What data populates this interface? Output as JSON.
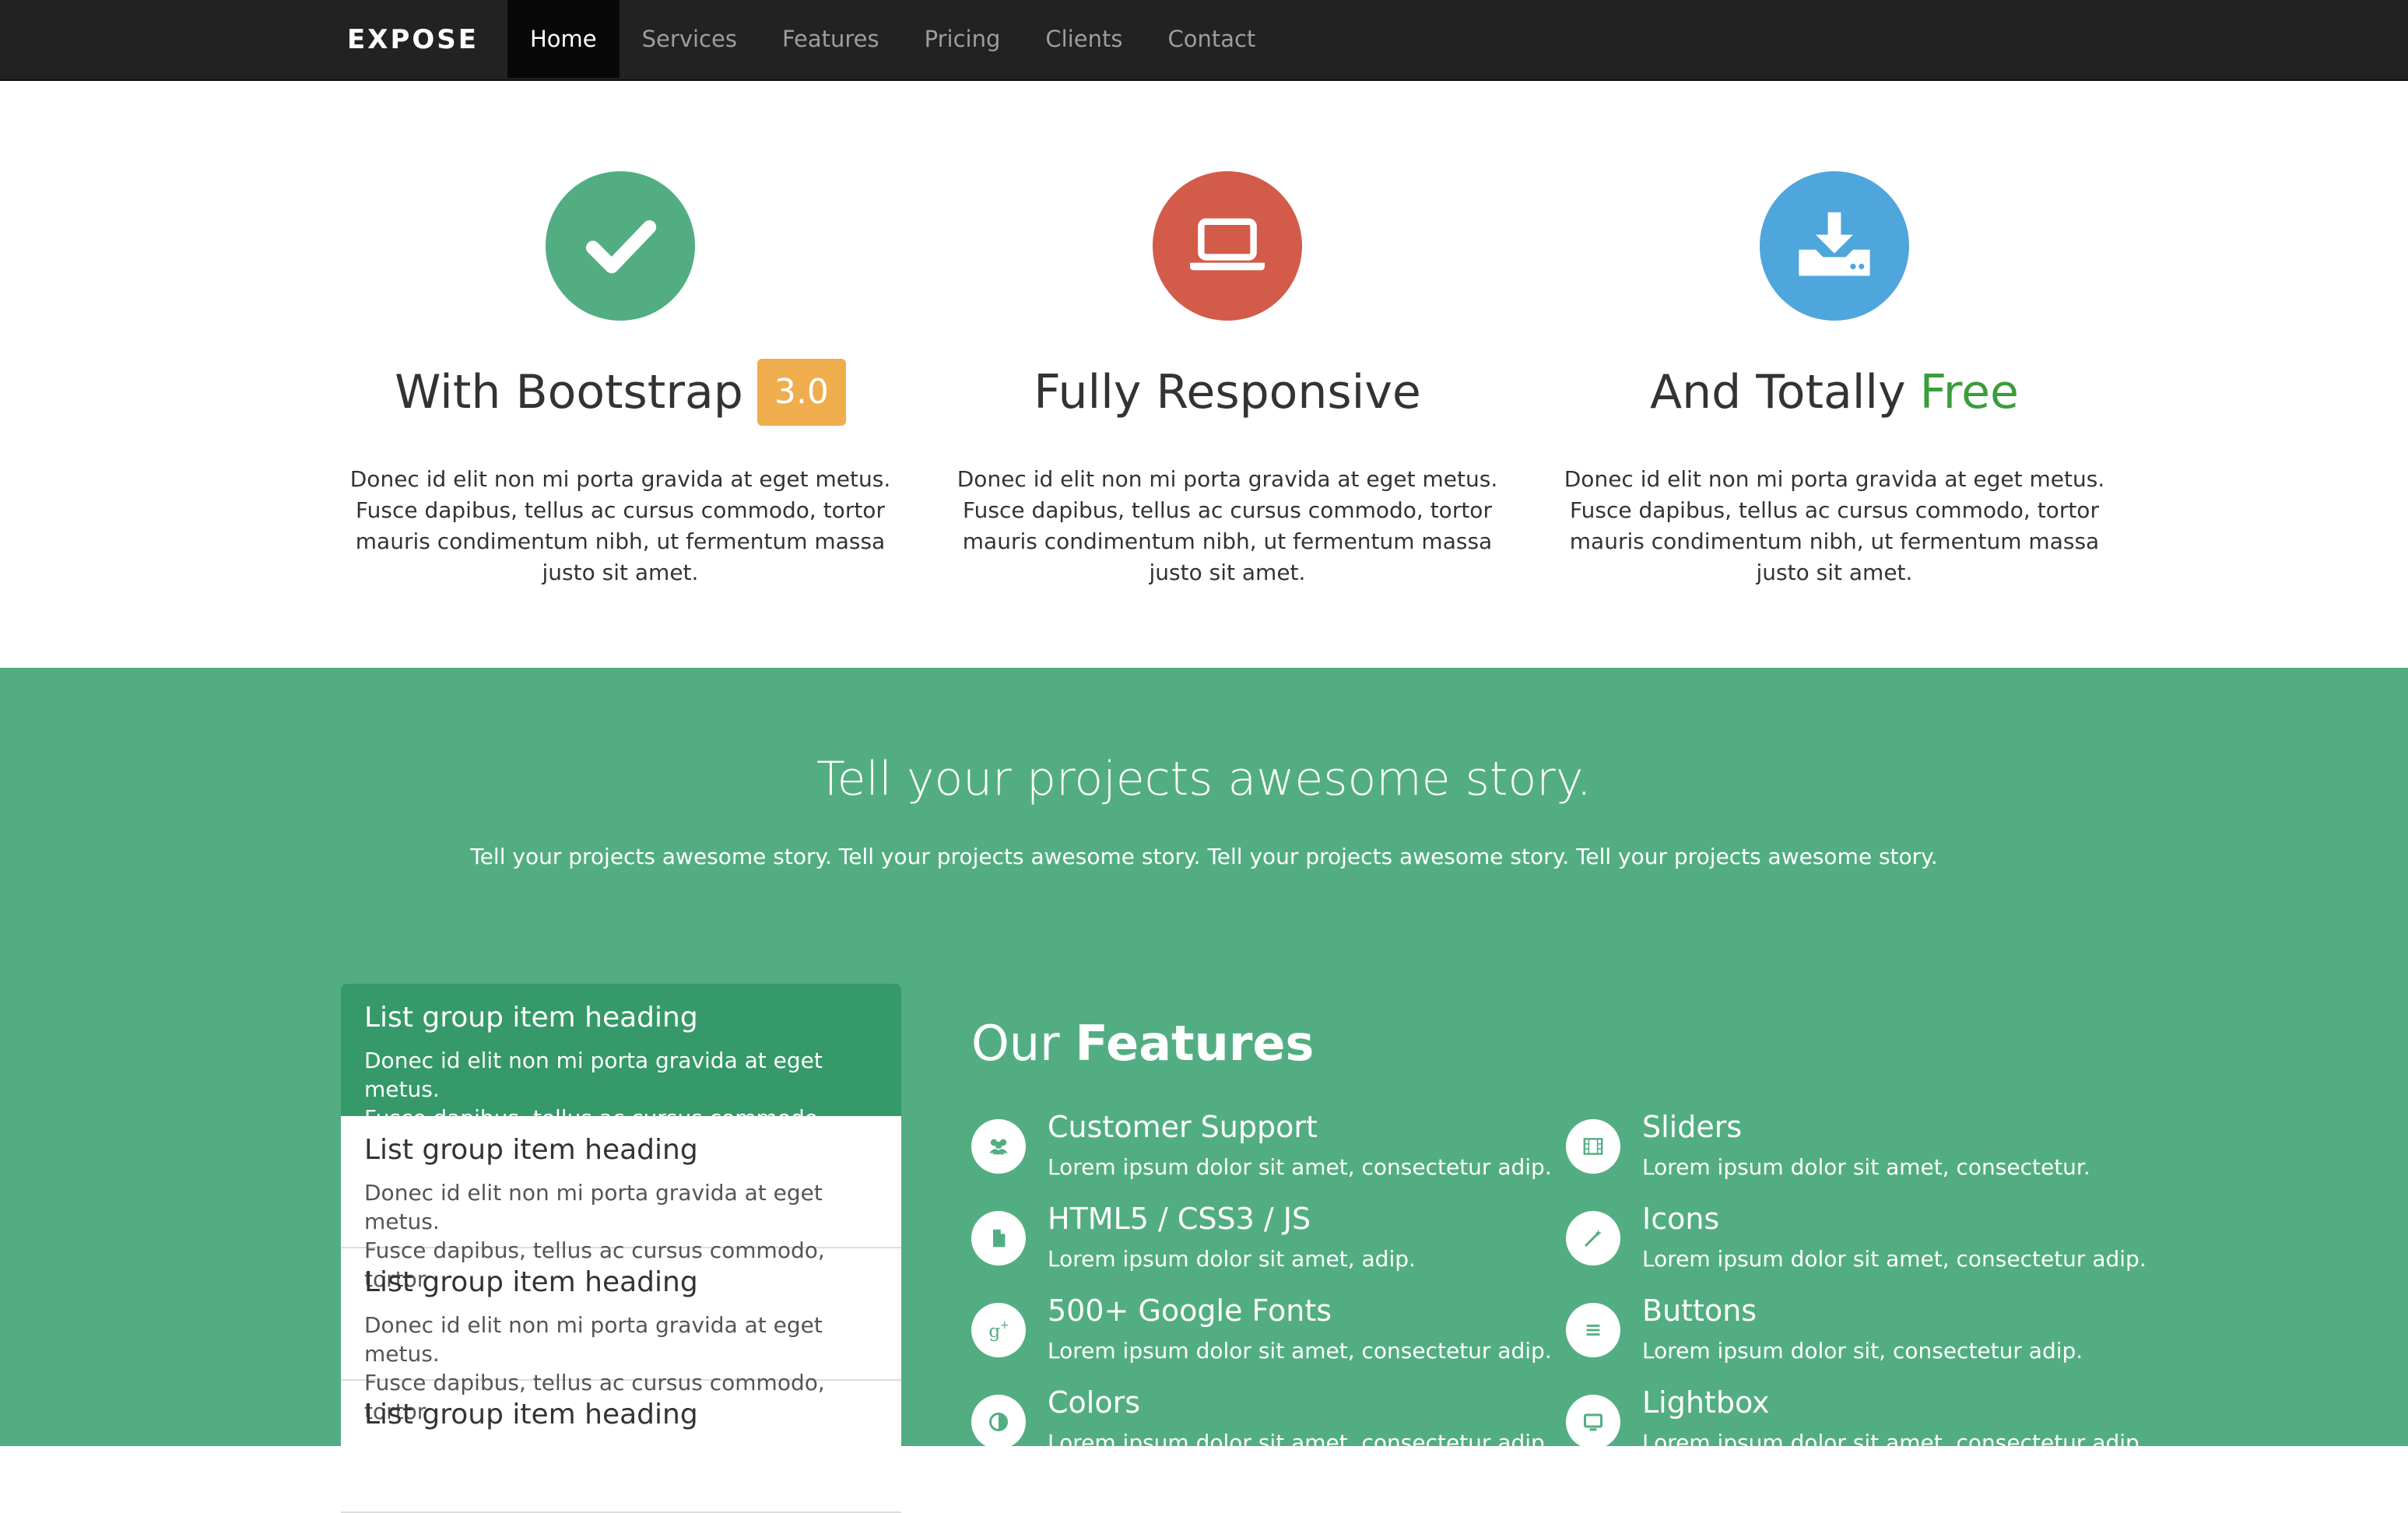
{
  "navbar": {
    "brand": "EXPOSE",
    "items": [
      {
        "label": "Home",
        "active": true
      },
      {
        "label": "Services"
      },
      {
        "label": "Features"
      },
      {
        "label": "Pricing"
      },
      {
        "label": "Clients"
      },
      {
        "label": "Contact"
      }
    ]
  },
  "top_features": [
    {
      "icon": "check-icon",
      "color": "#52ae82",
      "title": "With Bootstrap",
      "badge": "3.0",
      "text": "Donec id elit non mi porta gravida at eget metus. Fusce dapibus, tellus ac cursus commodo, tortor mauris condimentum nibh, ut fermentum massa justo sit amet."
    },
    {
      "icon": "laptop-icon",
      "color": "#d35b4a",
      "title": "Fully Responsive",
      "text": "Donec id elit non mi porta gravida at eget metus. Fusce dapibus, tellus ac cursus commodo, tortor mauris condimentum nibh, ut fermentum massa justo sit amet."
    },
    {
      "icon": "download-icon",
      "color": "#4ea6dc",
      "title": "And Totally",
      "title_highlight": "Free",
      "text": "Donec id elit non mi porta gravida at eget metus. Fusce dapibus, tellus ac cursus commodo, tortor mauris condimentum nibh, ut fermentum massa justo sit amet."
    }
  ],
  "story": {
    "title": "Tell your projects awesome story.",
    "text": "Tell your projects awesome story. Tell your projects awesome story. Tell your projects awesome story. Tell your projects awesome story."
  },
  "list_group": [
    {
      "heading": "List group item heading",
      "line1": "Donec id elit non mi porta gravida at eget metus.",
      "line2": "Fusce dapibus, tellus ac cursus commodo, tortor",
      "active": true
    },
    {
      "heading": "List group item heading",
      "line1": "Donec id elit non mi porta gravida at eget metus.",
      "line2": "Fusce dapibus, tellus ac cursus commodo, tortor"
    },
    {
      "heading": "List group item heading",
      "line1": "Donec id elit non mi porta gravida at eget metus.",
      "line2": "Fusce dapibus, tellus ac cursus commodo, tortor"
    },
    {
      "heading": "List group item heading",
      "line1": "",
      "line2": ""
    }
  ],
  "features": {
    "title_light": "Our",
    "title_bold": "Features",
    "items": [
      {
        "icon": "users-icon",
        "title": "Customer Support",
        "text": "Lorem ipsum dolor sit amet, consectetur adip."
      },
      {
        "icon": "film-icon",
        "title": "Sliders",
        "text": "Lorem ipsum dolor sit amet, consectetur."
      },
      {
        "icon": "file-icon",
        "title": "HTML5 / CSS3 / JS",
        "text": "Lorem ipsum dolor sit amet, adip."
      },
      {
        "icon": "magic-wand-icon",
        "title": "Icons",
        "text": "Lorem ipsum dolor sit amet, consectetur adip."
      },
      {
        "icon": "google-plus-icon",
        "title": "500+ Google Fonts",
        "text": "Lorem ipsum dolor sit amet, consectetur adip."
      },
      {
        "icon": "menu-lines-icon",
        "title": "Buttons",
        "text": "Lorem ipsum dolor sit, consectetur adip."
      },
      {
        "icon": "contrast-icon",
        "title": "Colors",
        "text": "Lorem ipsum dolor sit amet, consectetur adip."
      },
      {
        "icon": "monitor-icon",
        "title": "Lightbox",
        "text": "Lorem ipsum dolor sit amet, consectetur adip."
      }
    ]
  },
  "colors": {
    "navbar_bg": "#222222",
    "green_section": "#52ae82",
    "list_active": "#35996a",
    "badge": "#f0ad4e",
    "free_text": "#3a9d3a"
  }
}
